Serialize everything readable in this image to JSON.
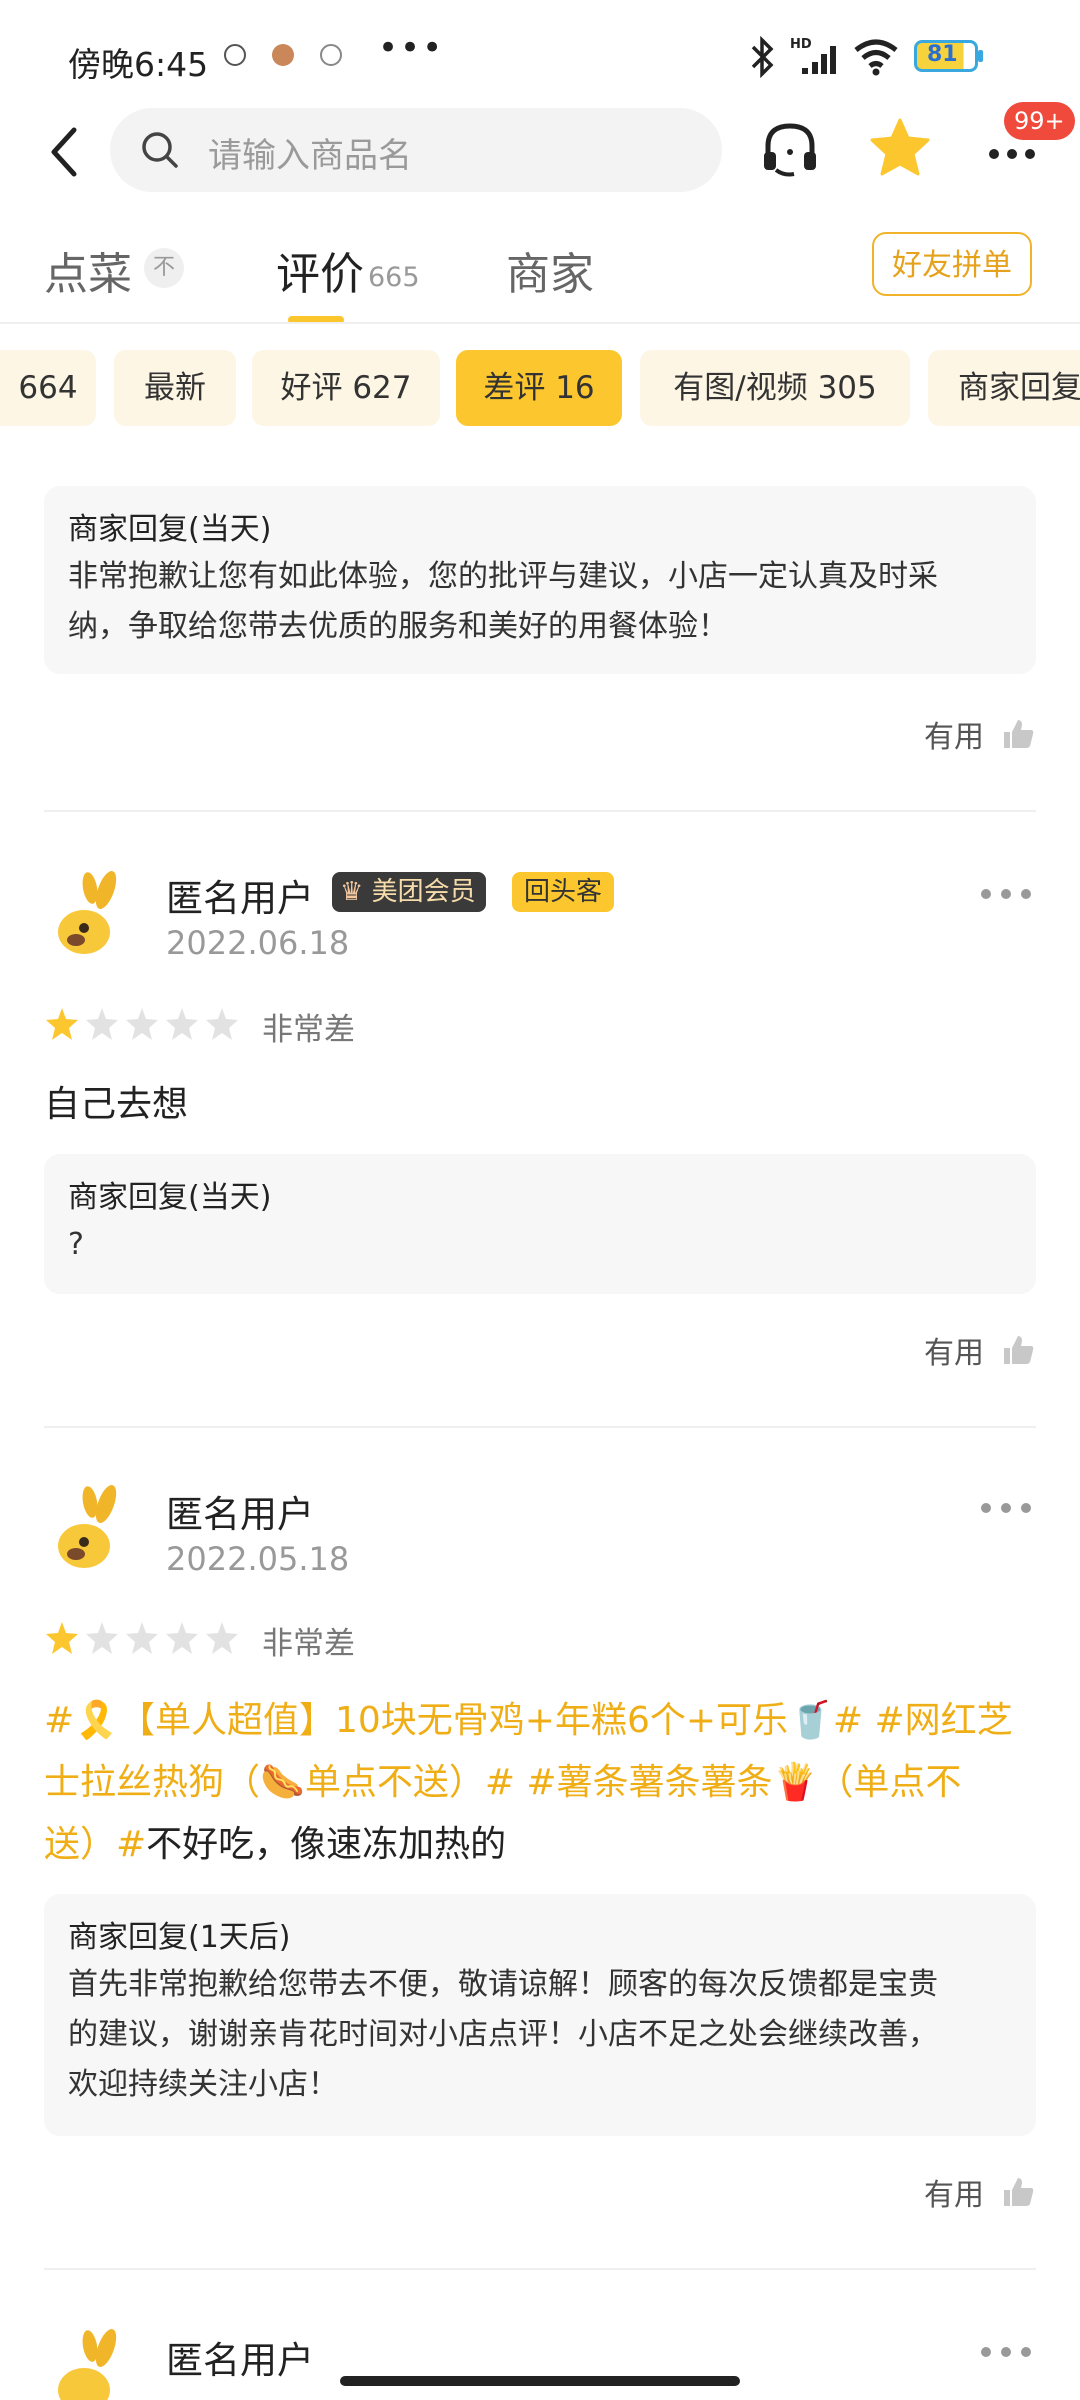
{
  "status_bar": {
    "time": "傍晚6:45",
    "battery": "81",
    "network": "HD"
  },
  "nav": {
    "search_placeholder": "请输入商品名",
    "badge": "99+"
  },
  "tabs": {
    "menu": "点菜",
    "pin": "不",
    "reviews": "评价",
    "reviews_count": "665",
    "merchant": "商家",
    "group_button": "好友拼单"
  },
  "filters": [
    {
      "label": "664"
    },
    {
      "label": "最新"
    },
    {
      "label": "好评 627"
    },
    {
      "label": "差评 16",
      "active": true
    },
    {
      "label": "有图/视频 305"
    },
    {
      "label": "商家回复"
    }
  ],
  "reviews": [
    {
      "reply_title": "商家回复(当天)",
      "reply_lines": [
        "非常抱歉让您有如此体验，您的批评与建议，小店一定认真及时采",
        "纳，争取给您带去优质的服务和美好的用餐体验！"
      ],
      "useful": "有用"
    },
    {
      "user": "匿名用户",
      "badge_vip": "美团会员",
      "badge_return": "回头客",
      "date": "2022.06.18",
      "stars": 1,
      "rating_text": "非常差",
      "content": "自己去想",
      "reply_title": "商家回复(当天)",
      "reply_lines": [
        "?"
      ],
      "useful": "有用"
    },
    {
      "user": "匿名用户",
      "date": "2022.05.18",
      "stars": 1,
      "rating_text": "非常差",
      "content_line1_tag": "#🎗️【单人超值】10块无骨鸡+年糕6个+可乐🥤# #网红芝",
      "content_line2_tag": "士拉丝热狗（🌭单点不送）# #薯条薯条薯条🍟（单点不",
      "content_line3_tag": "送）#",
      "content_line3_text": "不好吃，像速冻加热的",
      "reply_title": "商家回复(1天后)",
      "reply_lines": [
        "首先非常抱歉给您带去不便，敬请谅解！顾客的每次反馈都是宝贵",
        "的建议，谢谢亲肯花时间对小店点评！小店不足之处会继续改善，",
        "欢迎持续关注小店！"
      ],
      "useful": "有用"
    },
    {
      "user": "匿名用户"
    }
  ],
  "colors": {
    "accent": "#fcc72e",
    "tag": "#f0ae16",
    "badge_red": "#f04a3c"
  }
}
